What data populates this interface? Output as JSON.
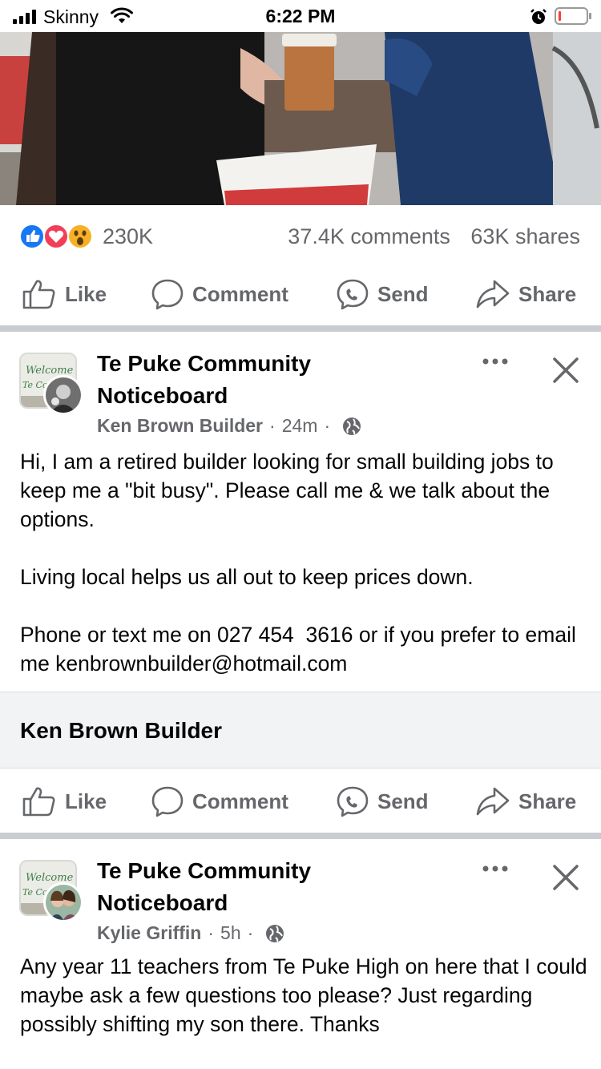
{
  "status_bar": {
    "carrier": "Skinny",
    "time": "6:22 PM"
  },
  "reactions": {
    "icons": [
      "like-reaction",
      "love-reaction",
      "wow-reaction"
    ],
    "count": "230K",
    "comments": "37.4K comments",
    "shares": "63K shares"
  },
  "actions": {
    "like": "Like",
    "comment": "Comment",
    "send": "Send",
    "share": "Share"
  },
  "posts": [
    {
      "group_line1": "Te Puke Community",
      "group_line2": "Noticeboard",
      "author": "Ken Brown Builder",
      "time": "24m",
      "body": [
        "Hi, I am a retired builder looking for small building jobs to keep me a \"bit busy\". Please call me & we talk about the options.",
        "Living local helps us all out to keep prices down.",
        "Phone or text me on 027 454  3616 or if you prefer to email me kenbrownbuilder@hotmail.com"
      ],
      "link_card_title": "Ken Brown Builder"
    },
    {
      "group_line1": "Te Puke Community",
      "group_line2": "Noticeboard",
      "author": "Kylie Griffin",
      "time": "5h",
      "body": [
        "Any year 11 teachers from Te Puke High on here that I could maybe ask a few questions too please? Just regarding possibly shifting my son there. Thanks"
      ]
    }
  ],
  "colors": {
    "like_blue": "#1877f2",
    "love_red": "#f33e58",
    "wow_yellow": "#f7b125",
    "secondary_text": "#65676b",
    "divider": "#c9ccd1"
  }
}
